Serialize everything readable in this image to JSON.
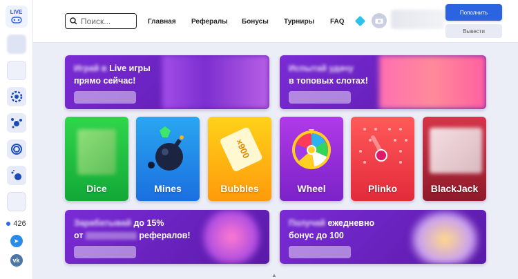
{
  "sidebar": {
    "logo_text": "LIVE",
    "online_count": "426"
  },
  "header": {
    "search_placeholder": "Поиск...",
    "nav": [
      "Главная",
      "Рефералы",
      "Бонусы",
      "Турниры",
      "FAQ"
    ],
    "deposit_label": "Пополнить",
    "withdraw_label": "Вывести"
  },
  "banners": {
    "live": {
      "line1_blur": "Играй в",
      "line1": "Live игры",
      "line2": "прямо сейчас!"
    },
    "slots": {
      "line1_blur": "Испытай удачу",
      "line2": "в топовых слотах!"
    },
    "referral": {
      "line1_blur": "Зарабатывай",
      "line1": "до 15%",
      "line2_a": "от",
      "line2_b": "рефералов!"
    },
    "daily": {
      "line1_blur": "Получай",
      "line1": "ежедневно",
      "line2": "бонус до 100"
    }
  },
  "games": [
    {
      "label": "Dice",
      "color_top": "#2fd64a",
      "color_bottom": "#12a838"
    },
    {
      "label": "Mines",
      "color_top": "#2aa6f0",
      "color_bottom": "#1a6fe0"
    },
    {
      "label": "Bubbles",
      "color_top": "#ffd21a",
      "color_bottom": "#ff9a0a"
    },
    {
      "label": "Wheel",
      "color_top": "#b03ae8",
      "color_bottom": "#7b22c8"
    },
    {
      "label": "Plinko",
      "color_top": "#ff5a5a",
      "color_bottom": "#e22a3a"
    },
    {
      "label": "BlackJack",
      "color_top": "#d6344a",
      "color_bottom": "#8e1a2a"
    }
  ],
  "colors": {
    "accent": "#2b63e0",
    "banner_purple": "#7a2bd6"
  }
}
